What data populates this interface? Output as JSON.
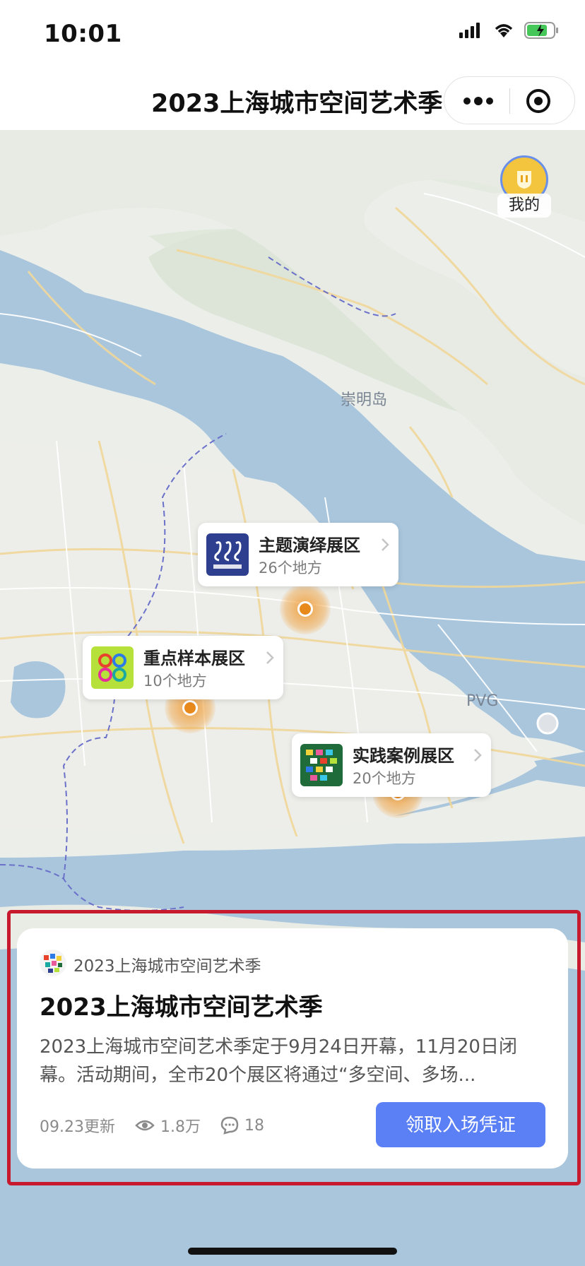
{
  "status_bar": {
    "time": "10:01"
  },
  "nav": {
    "title": "2023上海城市空间艺术季",
    "more_icon": "more-dots-icon",
    "close_icon": "target-close-icon"
  },
  "map": {
    "me_label": "我的",
    "place_labels": {
      "chongming": "崇明岛",
      "pvg": "PVG"
    },
    "zones": [
      {
        "title": "主题演绎展区",
        "count": "26个地方"
      },
      {
        "title": "重点样本展区",
        "count": "10个地方"
      },
      {
        "title": "实践案例展区",
        "count": "20个地方"
      }
    ]
  },
  "card": {
    "source_name": "2023上海城市空间艺术季",
    "headline": "2023上海城市空间艺术季",
    "description": "2023上海城市空间艺术季定于9月24日开幕，11月20日闭幕。活动期间，全市20个展区将通过“多空间、多场...",
    "updated": "09.23更新",
    "views": "1.8万",
    "comments": "18",
    "cta": "领取入场凭证"
  },
  "colors": {
    "accent": "#5b80f5",
    "pin": "#e8891c",
    "water": "#a9c6dd",
    "highlight_frame": "#c71a2e"
  }
}
